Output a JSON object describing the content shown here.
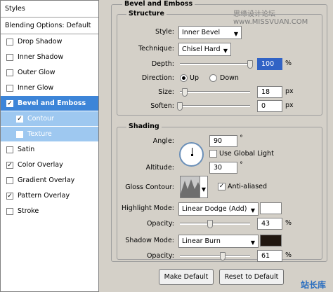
{
  "style_list": {
    "header": "Styles",
    "blending": "Blending Options: Default",
    "items": [
      {
        "label": "Drop Shadow",
        "checked": false,
        "state": "normal",
        "sub": false
      },
      {
        "label": "Inner Shadow",
        "checked": false,
        "state": "normal",
        "sub": false
      },
      {
        "label": "Outer Glow",
        "checked": false,
        "state": "normal",
        "sub": false
      },
      {
        "label": "Inner Glow",
        "checked": false,
        "state": "normal",
        "sub": false
      },
      {
        "label": "Bevel and Emboss",
        "checked": true,
        "state": "active",
        "sub": false
      },
      {
        "label": "Contour",
        "checked": true,
        "state": "subactive",
        "sub": true
      },
      {
        "label": "Texture",
        "checked": false,
        "state": "subactive",
        "sub": true
      },
      {
        "label": "Satin",
        "checked": false,
        "state": "normal",
        "sub": false
      },
      {
        "label": "Color Overlay",
        "checked": true,
        "state": "normal",
        "sub": false
      },
      {
        "label": "Gradient Overlay",
        "checked": false,
        "state": "normal",
        "sub": false
      },
      {
        "label": "Pattern Overlay",
        "checked": true,
        "state": "normal",
        "sub": false
      },
      {
        "label": "Stroke",
        "checked": false,
        "state": "normal",
        "sub": false
      }
    ]
  },
  "panel": {
    "title": "Bevel and Emboss",
    "structure": {
      "title": "Structure",
      "style_label": "Style:",
      "style_value": "Inner Bevel",
      "technique_label": "Technique:",
      "technique_value": "Chisel Hard",
      "depth_label": "Depth:",
      "depth_value": "100",
      "depth_unit": "%",
      "depth_fraction": 1.0,
      "direction_label": "Direction:",
      "direction_up": "Up",
      "direction_down": "Down",
      "direction_selected": "Up",
      "size_label": "Size:",
      "size_value": "18",
      "size_unit": "px",
      "size_fraction": 0.07,
      "soften_label": "Soften:",
      "soften_value": "0",
      "soften_unit": "px",
      "soften_fraction": 0.0
    },
    "shading": {
      "title": "Shading",
      "angle_label": "Angle:",
      "angle_value": "90",
      "angle_unit": "°",
      "global_light_label": "Use Global Light",
      "global_light_checked": false,
      "altitude_label": "Altitude:",
      "altitude_value": "30",
      "altitude_unit": "°",
      "gloss_label": "Gloss Contour:",
      "anti_aliased_label": "Anti-aliased",
      "anti_aliased_checked": true,
      "highlight_mode_label": "Highlight Mode:",
      "highlight_mode_value": "Linear Dodge (Add)",
      "highlight_color": "#ffffff",
      "highlight_opacity_label": "Opacity:",
      "highlight_opacity_value": "43",
      "highlight_opacity_unit": "%",
      "highlight_opacity_fraction": 0.43,
      "shadow_mode_label": "Shadow Mode:",
      "shadow_mode_value": "Linear Burn",
      "shadow_color": "#21170f",
      "shadow_opacity_label": "Opacity:",
      "shadow_opacity_value": "61",
      "shadow_opacity_unit": "%",
      "shadow_opacity_fraction": 0.61
    },
    "buttons": {
      "make_default": "Make Default",
      "reset_default": "Reset to Default"
    }
  },
  "watermarks": {
    "top": "思缘设计论坛 www.MISSVUAN.COM",
    "bottom": "站长库"
  },
  "colors": {
    "active_row": "#3d85d8",
    "subactive_row": "#9ec8f0",
    "dialog_bg": "#d4d0c8"
  }
}
